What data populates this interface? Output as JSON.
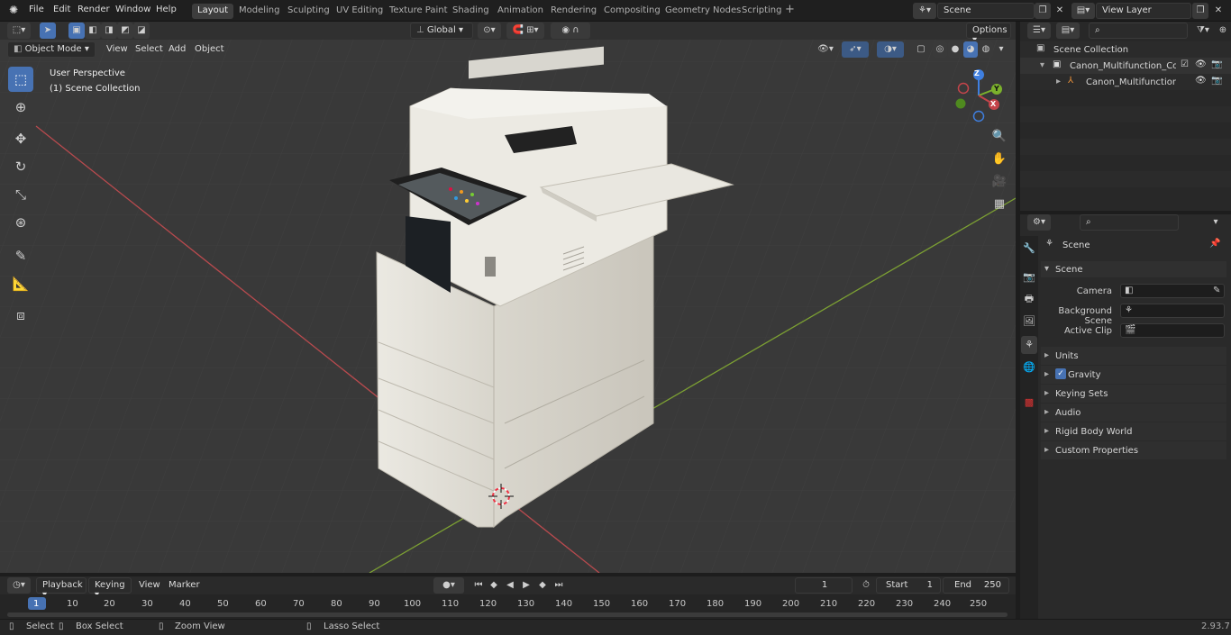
{
  "app_menu": [
    "File",
    "Edit",
    "Render",
    "Window",
    "Help"
  ],
  "workspace_tabs": [
    "Layout",
    "Modeling",
    "Sculpting",
    "UV Editing",
    "Texture Paint",
    "Shading",
    "Animation",
    "Rendering",
    "Compositing",
    "Geometry Nodes",
    "Scripting"
  ],
  "active_workspace": "Layout",
  "scene_field": "Scene",
  "view_layer_field": "View Layer",
  "viewport": {
    "mode": "Object Mode",
    "menus": [
      "View",
      "Select",
      "Add",
      "Object"
    ],
    "orientation": "Global",
    "options": "Options",
    "overlay_line1": "User Perspective",
    "overlay_line2": "(1) Scene Collection",
    "gizmo_axes": [
      "Z",
      "Y",
      "X"
    ]
  },
  "outliner": {
    "root": "Scene Collection",
    "items": [
      "Canon_Multifunction_Copier_I",
      "Canon_Multifunction_Cop"
    ]
  },
  "properties": {
    "header": "Scene",
    "section": "Scene",
    "fields": [
      "Camera",
      "Background Scene",
      "Active Clip"
    ],
    "panels": [
      "Units",
      "Gravity",
      "Keying Sets",
      "Audio",
      "Rigid Body World",
      "Custom Properties"
    ]
  },
  "timeline": {
    "menus": [
      "Playback",
      "Keying",
      "View",
      "Marker"
    ],
    "current_frame": "1",
    "start_label": "Start",
    "start": "1",
    "end_label": "End",
    "end": "250",
    "ruler": [
      "1",
      "10",
      "20",
      "30",
      "40",
      "50",
      "60",
      "70",
      "80",
      "90",
      "100",
      "110",
      "120",
      "130",
      "140",
      "150",
      "160",
      "170",
      "180",
      "190",
      "200",
      "210",
      "220",
      "230",
      "240",
      "250"
    ]
  },
  "status": {
    "select": "Select",
    "box_select": "Box Select",
    "zoom_view": "Zoom View",
    "lasso_select": "Lasso Select",
    "version": "2.93.7"
  },
  "colors": {
    "accent": "#4772b3",
    "x_axis": "#c4444a",
    "y_axis": "#7bb12c",
    "z_axis": "#3f7fe0"
  }
}
